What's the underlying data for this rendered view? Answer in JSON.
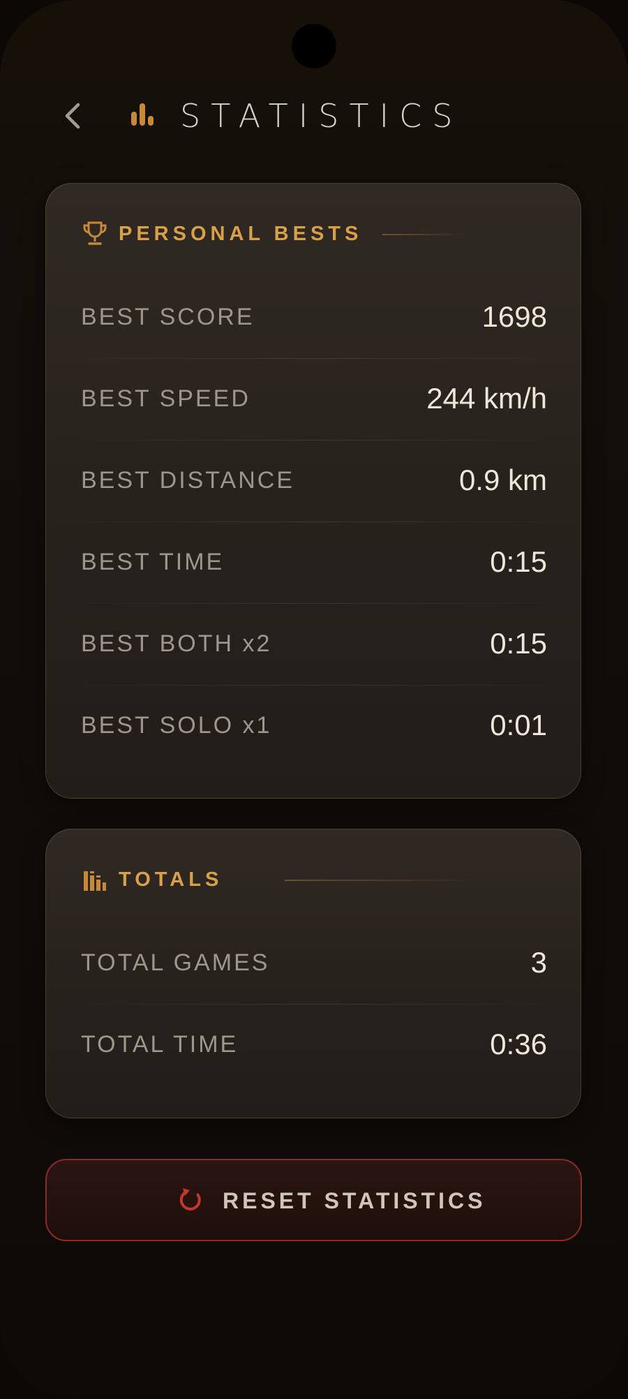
{
  "header": {
    "title": "STATISTICS",
    "back_icon": "chevron-left-icon",
    "title_icon": "bar-chart-icon",
    "accent_color": "#c8883c"
  },
  "personal_bests": {
    "title": "PERSONAL BESTS",
    "icon": "trophy-icon",
    "rows": [
      {
        "label": "BEST SCORE",
        "value": "1698"
      },
      {
        "label": "BEST SPEED",
        "value": "244 km/h"
      },
      {
        "label": "BEST DISTANCE",
        "value": "0.9 km"
      },
      {
        "label": "BEST TIME",
        "value": "0:15"
      },
      {
        "label": "BEST BOTH x2",
        "value": "0:15"
      },
      {
        "label": "BEST SOLO x1",
        "value": "0:01"
      }
    ]
  },
  "totals": {
    "title": "TOTALS",
    "icon": "stats-columns-icon",
    "rows": [
      {
        "label": "TOTAL GAMES",
        "value": "3"
      },
      {
        "label": "TOTAL TIME",
        "value": "0:36"
      }
    ]
  },
  "reset": {
    "label": "RESET STATISTICS",
    "icon": "reset-icon",
    "color": "#c0392b"
  }
}
